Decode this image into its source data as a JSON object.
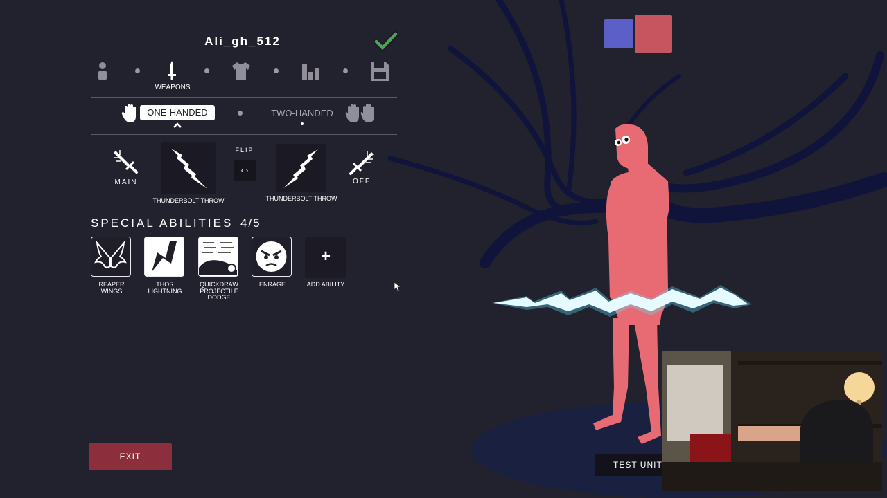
{
  "unit_name": "Ali_gh_512",
  "categories": {
    "active_label": "WEAPONS",
    "icons": [
      "unit-body-icon",
      "sword-icon",
      "shirt-icon",
      "stats-icon",
      "save-disk-icon"
    ]
  },
  "hand_modes": {
    "one_handed": "ONE-HANDED",
    "two_handed": "TWO-HANDED",
    "selected": "ONE-HANDED"
  },
  "weapons": {
    "main_label": "MAIN",
    "off_label": "OFF",
    "flip_label": "FLIP",
    "flip_icon_text": "‹ ›",
    "main_weapon": "THUNDERBOLT THROW",
    "off_weapon": "THUNDERBOLT THROW"
  },
  "abilities": {
    "title": "SPECIAL ABILITIES",
    "count": "4/5",
    "items": [
      {
        "label_line1": "REAPER",
        "label_line2": "WINGS",
        "label_line3": ""
      },
      {
        "label_line1": "THOR",
        "label_line2": "LIGHTNING",
        "label_line3": ""
      },
      {
        "label_line1": "QUICKDRAW",
        "label_line2": "PROJECTILE",
        "label_line3": "DODGE"
      },
      {
        "label_line1": "ENRAGE",
        "label_line2": "",
        "label_line3": ""
      }
    ],
    "add_symbol": "+",
    "add_label": "ADD ABILITY"
  },
  "buttons": {
    "exit": "EXIT",
    "test_unit": "TEST UNIT"
  },
  "teams": {
    "blue_color": "#5b5fc7",
    "red_color": "#c7555f"
  },
  "colors": {
    "background": "#22212e",
    "exit_button": "#8c2e3c",
    "unit_body": "#e86b74",
    "lightning": "#dff8ff"
  }
}
